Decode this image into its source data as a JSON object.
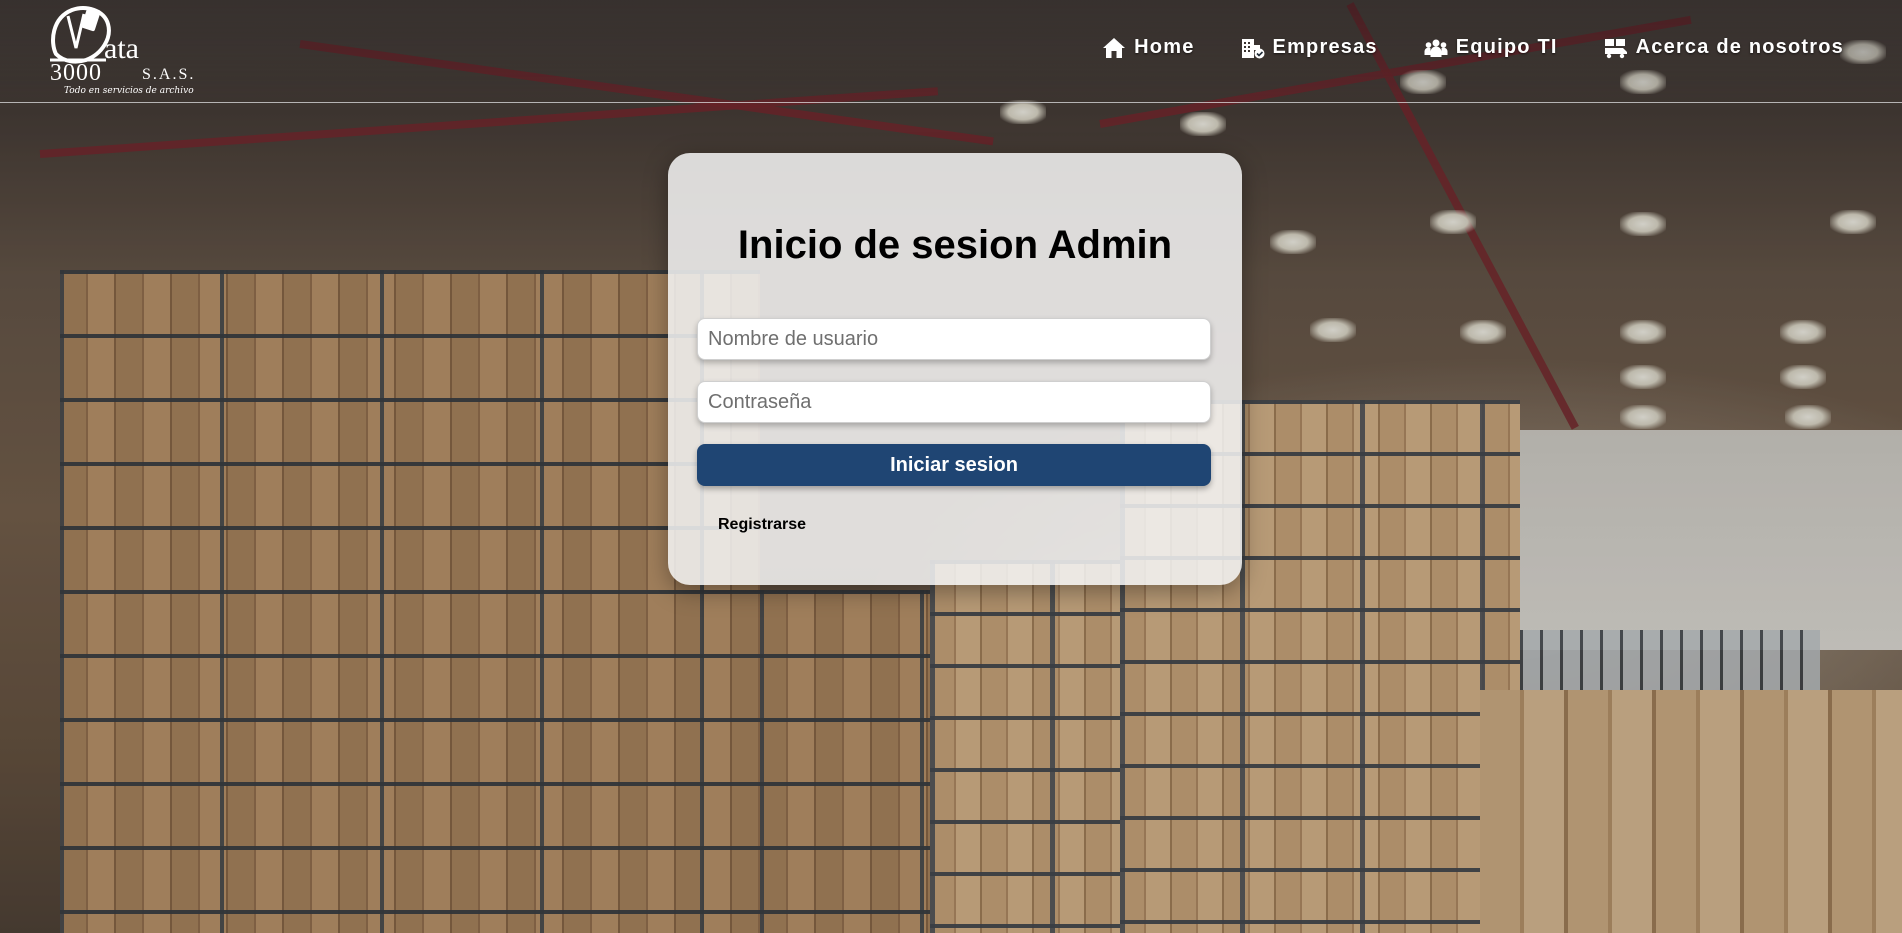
{
  "header": {
    "logo": {
      "name_part": "ata",
      "number": "3000",
      "suffix": "S.A.S.",
      "tagline": "Todo en servicios de archivo"
    },
    "nav": [
      {
        "label": "Home",
        "icon": "home-icon"
      },
      {
        "label": "Empresas",
        "icon": "buildings-check-icon"
      },
      {
        "label": "Equipo TI",
        "icon": "people-group-icon"
      },
      {
        "label": "Acerca de nosotros",
        "icon": "truck-boxes-icon"
      }
    ]
  },
  "login": {
    "title": "Inicio de sesion Admin",
    "username_placeholder": "Nombre de usuario",
    "password_placeholder": "Contraseña",
    "submit_label": "Iniciar sesion",
    "register_label": "Registrarse",
    "accent_color": "#1f4573"
  }
}
